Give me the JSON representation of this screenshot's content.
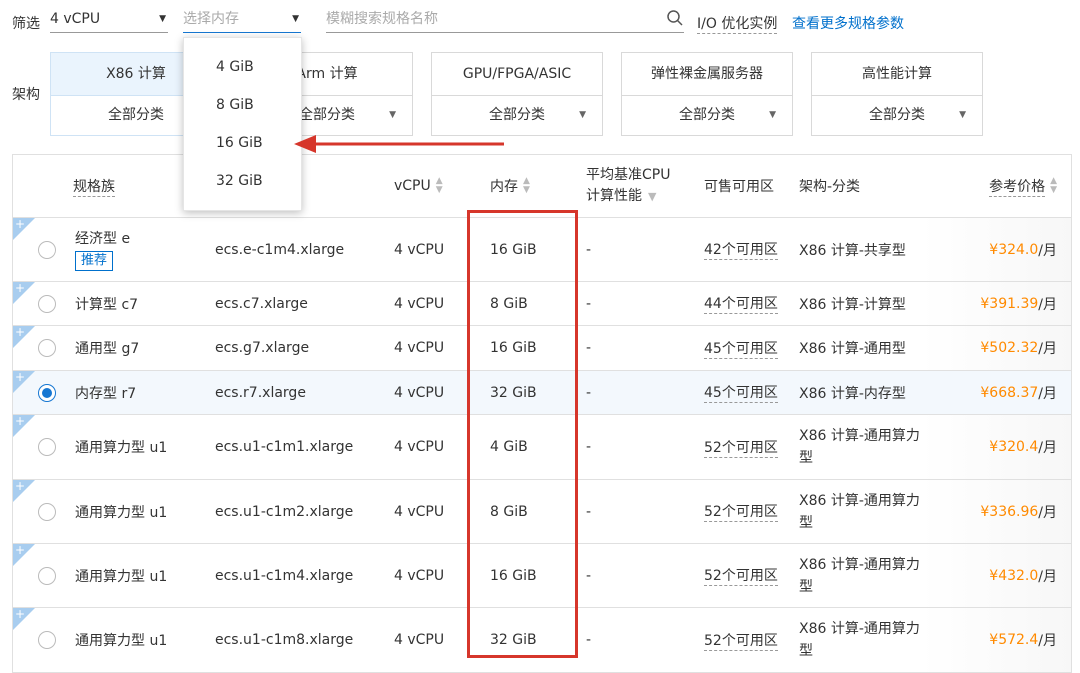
{
  "filters": {
    "label": "筛选",
    "vcpu_value": "4 vCPU",
    "memory_placeholder": "选择内存",
    "search_placeholder": "模糊搜索规格名称",
    "io_optimized": "I/O 优化实例",
    "more_params_link": "查看更多规格参数"
  },
  "memory_dropdown": {
    "options": [
      "4 GiB",
      "8 GiB",
      "16 GiB",
      "32 GiB"
    ]
  },
  "architecture": {
    "label": "架构",
    "cards": [
      {
        "title": "X86 计算",
        "sub": "全部分类"
      },
      {
        "title": "Arm 计算",
        "sub": "全部分类"
      },
      {
        "title": "GPU/FPGA/ASIC",
        "sub": "全部分类"
      },
      {
        "title": "弹性裸金属服务器",
        "sub": "全部分类"
      },
      {
        "title": "高性能计算",
        "sub": "全部分类"
      }
    ]
  },
  "table": {
    "headers": {
      "family": "规格族",
      "vcpu": "vCPU",
      "memory": "内存",
      "cpu_perf_1": "平均基准CPU",
      "cpu_perf_2": "计算性能",
      "zones": "可售可用区",
      "arch": "架构-分类",
      "price": "参考价格"
    },
    "recommend_badge": "推荐",
    "rows": [
      {
        "family": "经济型 e",
        "spec": "ecs.e-c1m4.xlarge",
        "vcpu": "4 vCPU",
        "memory": "16 GiB",
        "perf": "-",
        "zones": "42个可用区",
        "arch": "X86 计算-共享型",
        "price": "¥324.0",
        "unit": "/月"
      },
      {
        "family": "计算型 c7",
        "spec": "ecs.c7.xlarge",
        "vcpu": "4 vCPU",
        "memory": "8 GiB",
        "perf": "-",
        "zones": "44个可用区",
        "arch": "X86 计算-计算型",
        "price": "¥391.39",
        "unit": "/月"
      },
      {
        "family": "通用型 g7",
        "spec": "ecs.g7.xlarge",
        "vcpu": "4 vCPU",
        "memory": "16 GiB",
        "perf": "-",
        "zones": "45个可用区",
        "arch": "X86 计算-通用型",
        "price": "¥502.32",
        "unit": "/月"
      },
      {
        "family": "内存型 r7",
        "spec": "ecs.r7.xlarge",
        "vcpu": "4 vCPU",
        "memory": "32 GiB",
        "perf": "-",
        "zones": "45个可用区",
        "arch": "X86 计算-内存型",
        "price": "¥668.37",
        "unit": "/月"
      },
      {
        "family": "通用算力型 u1",
        "spec": "ecs.u1-c1m1.xlarge",
        "vcpu": "4 vCPU",
        "memory": "4 GiB",
        "perf": "-",
        "zones": "52个可用区",
        "arch_1": "X86 计算-通用算力",
        "arch_2": "型",
        "price": "¥320.4",
        "unit": "/月"
      },
      {
        "family": "通用算力型 u1",
        "spec": "ecs.u1-c1m2.xlarge",
        "vcpu": "4 vCPU",
        "memory": "8 GiB",
        "perf": "-",
        "zones": "52个可用区",
        "arch_1": "X86 计算-通用算力",
        "arch_2": "型",
        "price": "¥336.96",
        "unit": "/月"
      },
      {
        "family": "通用算力型 u1",
        "spec": "ecs.u1-c1m4.xlarge",
        "vcpu": "4 vCPU",
        "memory": "16 GiB",
        "perf": "-",
        "zones": "52个可用区",
        "arch_1": "X86 计算-通用算力",
        "arch_2": "型",
        "price": "¥432.0",
        "unit": "/月"
      },
      {
        "family": "通用算力型 u1",
        "spec": "ecs.u1-c1m8.xlarge",
        "vcpu": "4 vCPU",
        "memory": "32 GiB",
        "perf": "-",
        "zones": "52个可用区",
        "arch_1": "X86 计算-通用算力",
        "arch_2": "型",
        "price": "¥572.4",
        "unit": "/月"
      }
    ]
  },
  "colors": {
    "accent": "#0070cc",
    "price": "#ff8a00",
    "highlight": "#d6362b",
    "selected_row": "#f3f8fd"
  }
}
